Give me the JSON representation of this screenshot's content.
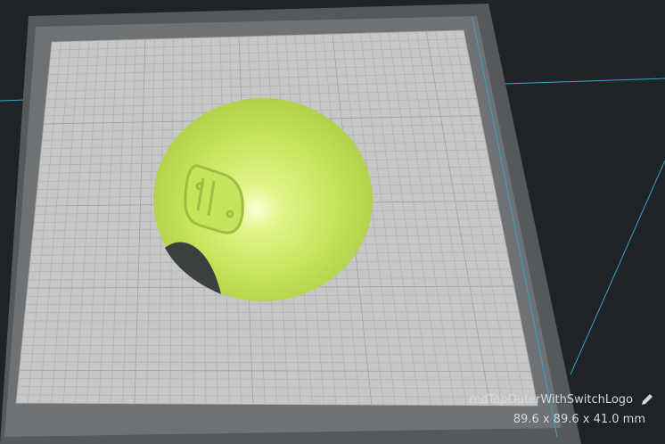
{
  "model": {
    "name": "redTopOuterWithSwitchLogo",
    "dimensions": "89.6 x 89.6 x 41.0 mm"
  },
  "colors": {
    "background": "#1e2327",
    "model": "#c9e65c",
    "plate": "#c8c8c8",
    "frame": "#5a5e60",
    "axis": "#3aa0c8"
  }
}
